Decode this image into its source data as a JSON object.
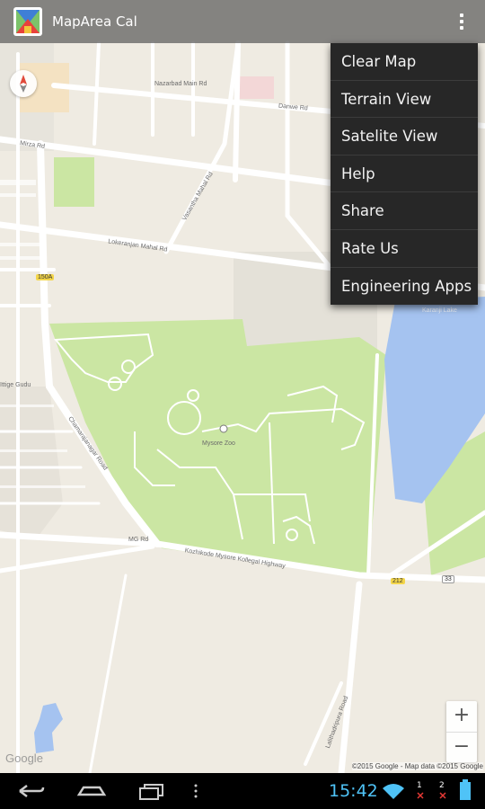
{
  "app": {
    "title": "MapArea Cal",
    "icon": "app-logo-icon"
  },
  "menu": {
    "items": [
      {
        "label": "Clear Map"
      },
      {
        "label": "Terrain View"
      },
      {
        "label": "Satelite View"
      },
      {
        "label": "Help"
      },
      {
        "label": "Share"
      },
      {
        "label": "Rate Us"
      },
      {
        "label": "Engineering Apps"
      }
    ]
  },
  "map": {
    "labels": {
      "nazarbad": "Nazarbad Main Rd",
      "danwe": "Danwe Rd",
      "mirza": "Mirza Rd",
      "vasantha": "Vasantha Mahal Rd",
      "lokeranjan": "Lokeranjan Mahal Rd",
      "shield_150a": "150A",
      "chamarajanagar": "Chamarajanagar Road",
      "mysore_zoo": "Mysore Zoo",
      "mg_rd": "MG Rd",
      "kozhikode": "Kozhikode Mysore Kollegal Highway",
      "shield_212": "212",
      "shield_33": "33",
      "karanji": "Karanji Lake",
      "ittige_gudu": "Ittige Gudu",
      "lalitha": "Lalithadripura Road"
    },
    "zoom_in": "+",
    "zoom_out": "−",
    "google_logo": "Google",
    "attribution": "©2015 Google - Map data ©2015 Google",
    "colors": {
      "land": "#efebe2",
      "park": "#cbe6a3",
      "water": "#a5c3f0",
      "road": "#ffffff"
    }
  },
  "status": {
    "time": "15:42"
  }
}
